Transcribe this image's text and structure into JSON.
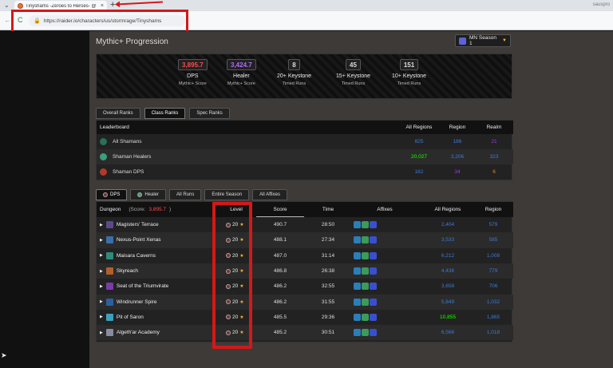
{
  "browser": {
    "tab_title": "Tinyshams -Zeroes to Heroes- @",
    "tab_close": "×",
    "new_tab": "+",
    "url": "https://raider.io/characters/us/stormrage/Tinyshams",
    "profile": "sauspro"
  },
  "page": {
    "title": "Mythic+ Progression",
    "season": "MN Season 1"
  },
  "stats": [
    {
      "value": "3,895.7",
      "label": "DPS",
      "sub": "Mythic+ Score",
      "color": "#ff4b4b"
    },
    {
      "value": "3,424.7",
      "label": "Healer",
      "sub": "Mythic+ Score",
      "color": "#b36bff"
    },
    {
      "value": "8",
      "label": "20+ Keystone",
      "sub": "Timed Runs",
      "color": "#ffffff"
    },
    {
      "value": "45",
      "label": "15+ Keystone",
      "sub": "Timed Runs",
      "color": "#ffffff"
    },
    {
      "value": "151",
      "label": "10+ Keystone",
      "sub": "Timed Runs",
      "color": "#ffffff"
    }
  ],
  "rank_tabs": [
    "Overall Ranks",
    "Class Ranks",
    "Spec Ranks"
  ],
  "leaderboard": {
    "headers": [
      "Leaderboard",
      "All Regions",
      "Region",
      "Realm"
    ],
    "rows": [
      {
        "name": "All Shamans",
        "all": "825",
        "region": "186",
        "realm": "21",
        "all_color": "#3a7bd5",
        "region_color": "#3a7bd5",
        "realm_color": "#a335ee"
      },
      {
        "name": "Shaman Healers",
        "all": "20,027",
        "region": "3,206",
        "realm": "323",
        "all_color": "#1eff00",
        "region_color": "#3a7bd5",
        "realm_color": "#3a7bd5"
      },
      {
        "name": "Shaman DPS",
        "all": "162",
        "region": "34",
        "realm": "6",
        "all_color": "#3a7bd5",
        "region_color": "#a335ee",
        "realm_color": "#ff8000"
      }
    ]
  },
  "run_tabs": {
    "dps": "DPS",
    "healer": "Healer",
    "all_runs": "All Runs",
    "entire_season": "Entire Season",
    "all_affixes": "All Affixes"
  },
  "runs": {
    "dungeon_header": "Dungeon",
    "score_prefix": "(Score: ",
    "score_value": "3,895.7",
    "score_suffix": ")",
    "headers": [
      "Level",
      "Score",
      "Time",
      "Affixes",
      "All Regions",
      "Region"
    ],
    "rows": [
      {
        "dungeon": "Magisters' Terrace",
        "level": "20",
        "score": "490.7",
        "time": "28:50",
        "all": "2,404",
        "region": "579",
        "icon": "#5a4a8a",
        "all_color": "#3a7bd5",
        "region_color": "#3a7bd5"
      },
      {
        "dungeon": "Nexus-Point Xenas",
        "level": "20",
        "score": "488.1",
        "time": "27:34",
        "all": "3,533",
        "region": "585",
        "icon": "#3b6fa8",
        "all_color": "#3a7bd5",
        "region_color": "#3a7bd5"
      },
      {
        "dungeon": "Maisara Caverns",
        "level": "20",
        "score": "487.0",
        "time": "31:14",
        "all": "6,212",
        "region": "1,008",
        "icon": "#2f8a7a",
        "all_color": "#3a7bd5",
        "region_color": "#3a7bd5"
      },
      {
        "dungeon": "Skyreach",
        "level": "20",
        "score": "486.8",
        "time": "26:38",
        "all": "4,436",
        "region": "779",
        "icon": "#b0602a",
        "all_color": "#3a7bd5",
        "region_color": "#3a7bd5"
      },
      {
        "dungeon": "Seat of the Triumvirate",
        "level": "20",
        "score": "486.2",
        "time": "32:55",
        "all": "3,658",
        "region": "706",
        "icon": "#7a3aa8",
        "all_color": "#3a7bd5",
        "region_color": "#3a7bd5"
      },
      {
        "dungeon": "Windrunner Spire",
        "level": "20",
        "score": "486.2",
        "time": "31:55",
        "all": "5,849",
        "region": "1,032",
        "icon": "#2d5fa0",
        "all_color": "#3a7bd5",
        "region_color": "#3a7bd5"
      },
      {
        "dungeon": "Pit of Saron",
        "level": "20",
        "score": "485.5",
        "time": "29:36",
        "all": "10,855",
        "region": "1,865",
        "icon": "#3aa0c0",
        "all_color": "#1eff00",
        "region_color": "#3a7bd5"
      },
      {
        "dungeon": "Algeth'ar Academy",
        "level": "20",
        "score": "485.2",
        "time": "30:51",
        "all": "6,566",
        "region": "1,018",
        "icon": "#8a8aa0",
        "all_color": "#3a7bd5",
        "region_color": "#3a7bd5"
      }
    ]
  },
  "colors": {
    "affix1": "#2b7fb8",
    "affix2": "#3c9a5a",
    "affix3": "#3a4fd0",
    "star": "#f5b52b"
  }
}
